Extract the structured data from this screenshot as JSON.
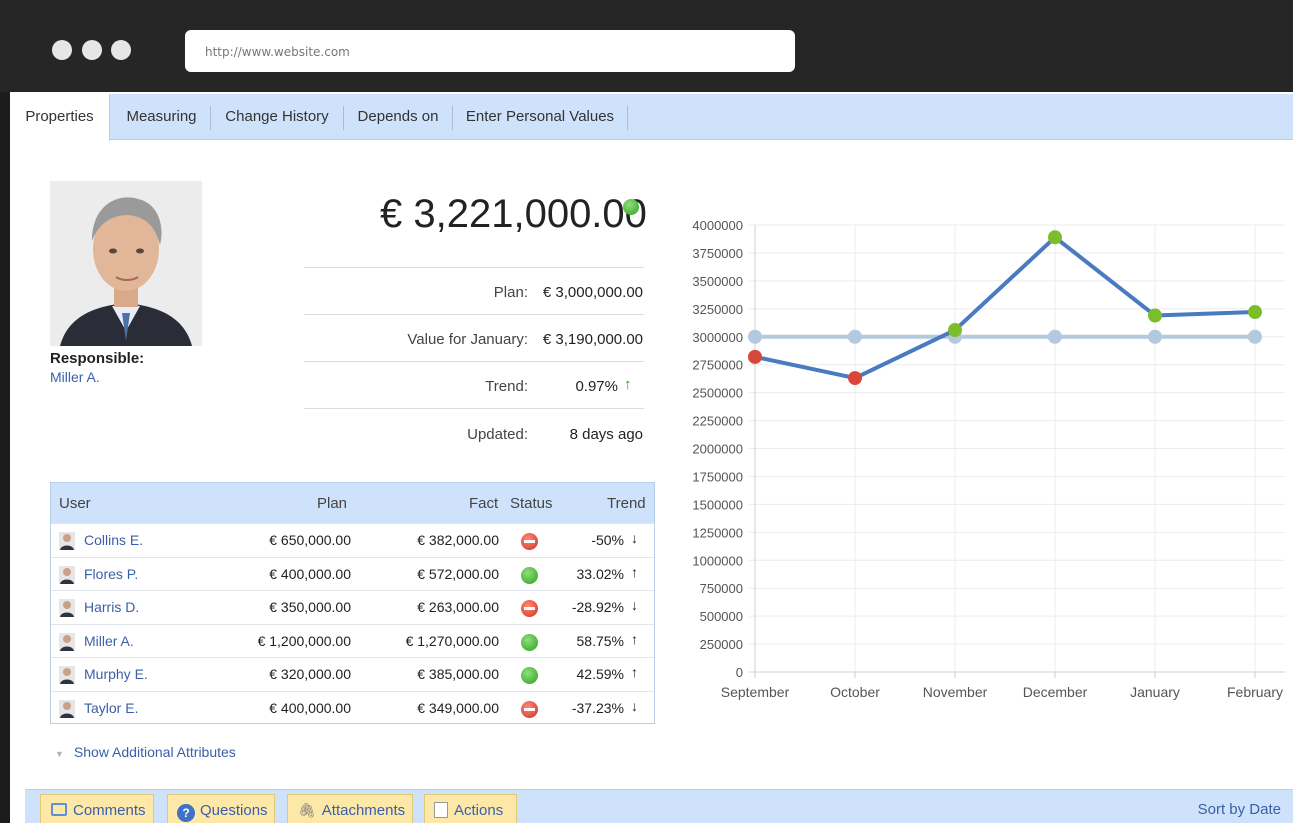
{
  "browser": {
    "url": "http://www.website.com"
  },
  "tabs": [
    "Properties",
    "Measuring",
    "Change History",
    "Depends on",
    "Enter Personal Values"
  ],
  "profile": {
    "label": "Responsible:",
    "name": "Miller A."
  },
  "kpi": {
    "value": "€ 3,221,000.00",
    "status_color": "#2e9e1e",
    "rows": [
      {
        "label": "Plan:",
        "value": "€ 3,000,000.00"
      },
      {
        "label": "Value for January:",
        "value": "€ 3,190,000.00"
      },
      {
        "label": "Trend:",
        "value": "0.97%",
        "arrow": "↑"
      },
      {
        "label": "Updated:",
        "value": "8 days ago"
      }
    ]
  },
  "table": {
    "headers": {
      "user": "User",
      "plan": "Plan",
      "fact": "Fact",
      "status": "Status",
      "trend": "Trend"
    },
    "rows": [
      {
        "user": "Collins E.",
        "plan": "€ 650,000.00",
        "fact": "€ 382,000.00",
        "status": "red",
        "trend": "-50%",
        "arrow": "↓"
      },
      {
        "user": "Flores P.",
        "plan": "€ 400,000.00",
        "fact": "€ 572,000.00",
        "status": "green",
        "trend": "33.02%",
        "arrow": "↑"
      },
      {
        "user": "Harris D.",
        "plan": "€ 350,000.00",
        "fact": "€ 263,000.00",
        "status": "red",
        "trend": "-28.92%",
        "arrow": "↓"
      },
      {
        "user": "Miller A.",
        "plan": "€ 1,200,000.00",
        "fact": "€ 1,270,000.00",
        "status": "green",
        "trend": "58.75%",
        "arrow": "↑"
      },
      {
        "user": "Murphy E.",
        "plan": "€ 320,000.00",
        "fact": "€ 385,000.00",
        "status": "green",
        "trend": "42.59%",
        "arrow": "↑"
      },
      {
        "user": "Taylor E.",
        "plan": "€ 400,000.00",
        "fact": "€ 349,000.00",
        "status": "red",
        "trend": "-37.23%",
        "arrow": "↓"
      }
    ]
  },
  "show_attrs": "Show Additional Attributes",
  "bottombar": {
    "buttons": [
      "Comments",
      "Questions",
      "Attachments",
      "Actions"
    ],
    "sort": "Sort by Date"
  },
  "chart_data": {
    "type": "line",
    "categories": [
      "September",
      "October",
      "November",
      "December",
      "January",
      "February"
    ],
    "ylim": [
      0,
      4000000
    ],
    "yticks": [
      0,
      250000,
      500000,
      750000,
      1000000,
      1250000,
      1500000,
      1750000,
      2000000,
      2250000,
      2500000,
      2750000,
      3000000,
      3250000,
      3500000,
      3750000,
      4000000
    ],
    "grid": true,
    "series": [
      {
        "values": [
          3000000,
          3000000,
          3000000,
          3000000,
          3000000,
          3000000
        ],
        "color": "#b3c9df"
      },
      {
        "values": [
          2820000,
          2630000,
          3060000,
          3890000,
          3190000,
          3221000
        ],
        "color": "#4a7ac0",
        "point_colors": [
          "#d9473a",
          "#d9473a",
          "#7bbd2a",
          "#7bbd2a",
          "#7bbd2a",
          "#7bbd2a"
        ]
      }
    ]
  }
}
